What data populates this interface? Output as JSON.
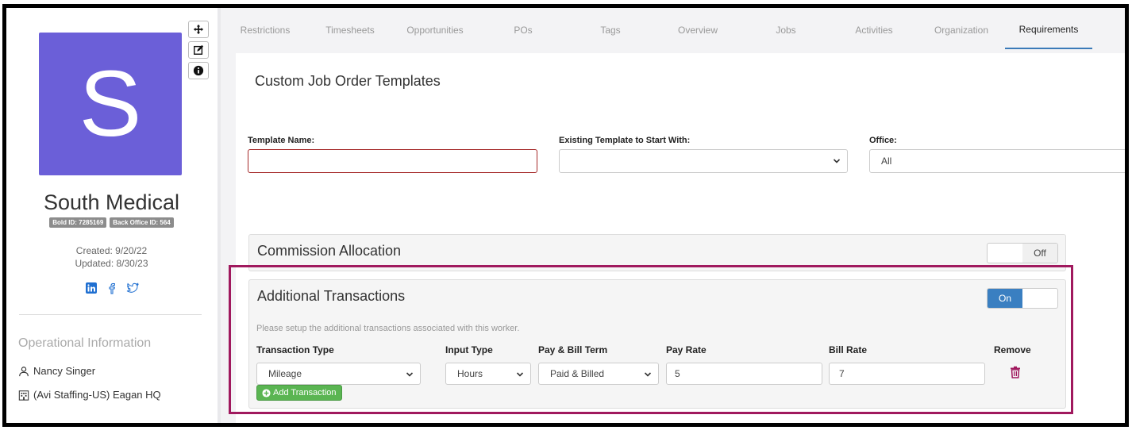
{
  "company": {
    "initial": "S",
    "name": "South Medical",
    "bold_id": "Bold ID: 7285169",
    "back_office_id": "Back Office ID: 564",
    "created": "Created: 9/20/22",
    "updated": "Updated: 8/30/23"
  },
  "side_tools": [
    "move-icon",
    "edit-icon",
    "info-icon"
  ],
  "socials": [
    "linkedin-icon",
    "facebook-icon",
    "twitter-icon"
  ],
  "operational": {
    "title": "Operational Information",
    "owner": "Nancy Singer",
    "office": "(Avi Staffing-US) Eagan HQ"
  },
  "tabs": [
    "Restrictions",
    "Timesheets",
    "Opportunities",
    "POs",
    "Tags",
    "Overview",
    "Jobs",
    "Activities",
    "Organization",
    "Requirements"
  ],
  "active_tab": "Requirements",
  "page": {
    "title": "Custom Job Order Templates",
    "template_name_label": "Template Name:",
    "template_name_value": "",
    "existing_template_label": "Existing Template to Start With:",
    "existing_template_value": "",
    "office_label": "Office:",
    "office_value": "All"
  },
  "commission": {
    "title": "Commission Allocation",
    "toggle_label": "Off",
    "state": "off"
  },
  "additional": {
    "title": "Additional Transactions",
    "toggle_label": "On",
    "state": "on",
    "help": "Please setup the additional transactions associated with this worker.",
    "headers": {
      "transaction_type": "Transaction Type",
      "input_type": "Input Type",
      "pay_bill_term": "Pay & Bill Term",
      "pay_rate": "Pay Rate",
      "bill_rate": "Bill Rate",
      "remove": "Remove"
    },
    "row": {
      "transaction_type": "Mileage",
      "input_type": "Hours",
      "pay_bill_term": "Paid & Billed",
      "pay_rate": "5",
      "bill_rate": "7"
    },
    "add_button": "Add Transaction"
  },
  "colors": {
    "avatar": "#6b5fd8",
    "toggle_on": "#3a7fc1",
    "add_button": "#5ab552",
    "highlight": "#a0195e",
    "trash": "#a0195e"
  }
}
